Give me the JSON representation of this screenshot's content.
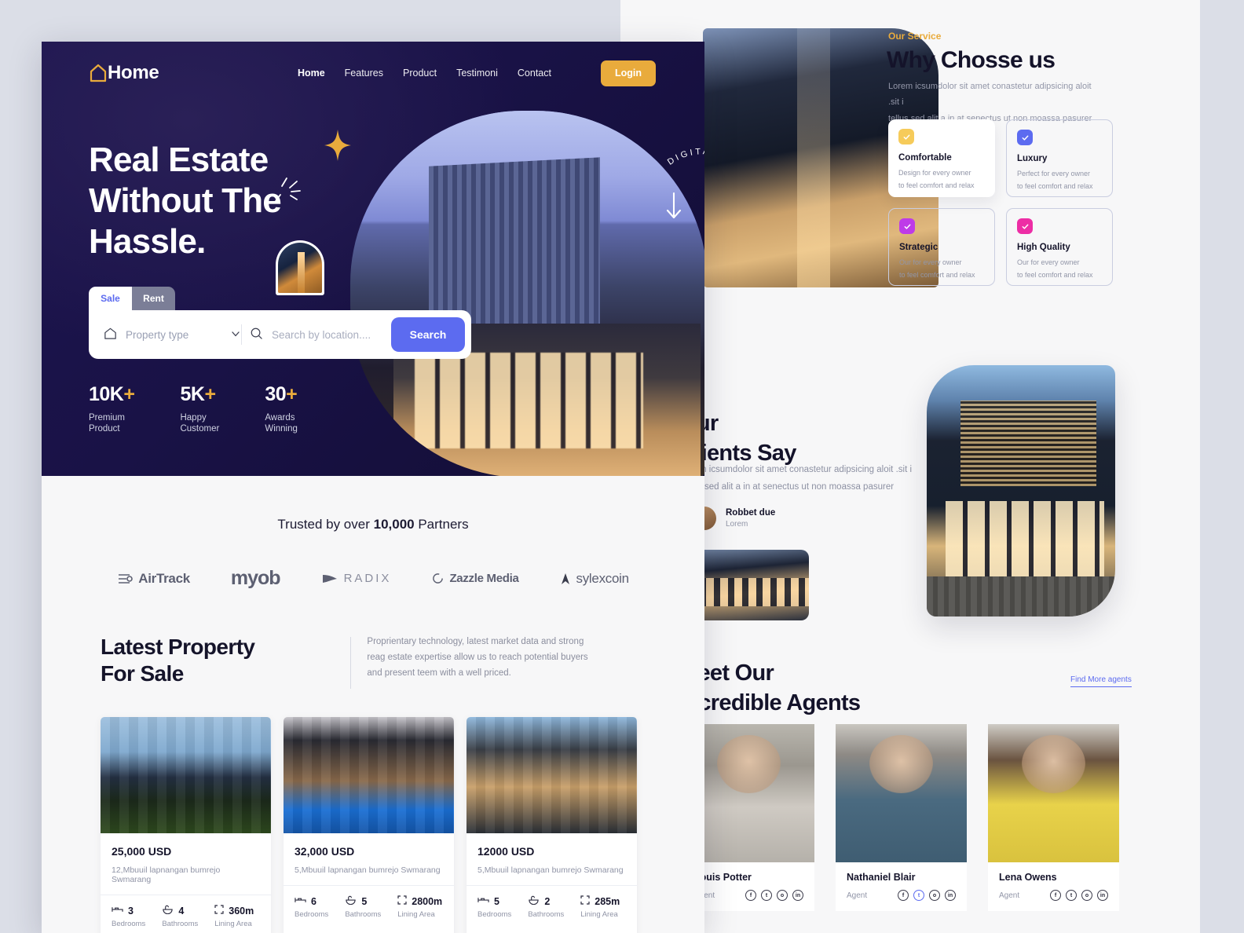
{
  "nav": {
    "logo_text": "Home",
    "logo_icon": "house-outline-icon",
    "links": [
      {
        "label": "Home",
        "active": true
      },
      {
        "label": "Features",
        "active": false
      },
      {
        "label": "Product",
        "active": false
      },
      {
        "label": "Testimoni",
        "active": false
      },
      {
        "label": "Contact",
        "active": false
      }
    ],
    "login_label": "Login"
  },
  "hero": {
    "headline": "Real Estate\nWithout The\nHassle.",
    "badge_text": "DIGITAL AGENCY THAT HELP Y",
    "tabs": [
      {
        "label": "Sale",
        "active": true
      },
      {
        "label": "Rent",
        "active": false
      }
    ],
    "property_type_placeholder": "Property type",
    "location_placeholder": "Search by location....",
    "search_label": "Search",
    "stats": [
      {
        "value": "10K",
        "plus": "+",
        "label": "Premium\nProduct"
      },
      {
        "value": "5K",
        "plus": "+",
        "label": "Happy\nCustomer"
      },
      {
        "value": "30",
        "plus": "+",
        "label": "Awards\nWinning"
      }
    ]
  },
  "partners": {
    "title_pre": "Trusted by over ",
    "title_bold": "10,000",
    "title_post": " Partners",
    "logos": [
      {
        "name": "AirTrack"
      },
      {
        "name": "myob"
      },
      {
        "name": "RADIX"
      },
      {
        "name": "Zazzle Media"
      },
      {
        "name": "sylexcoin"
      }
    ]
  },
  "latest": {
    "title": "Latest Property\nFor Sale",
    "description": "Proprientary technology, latest market data and strong reag estate expertise allow us to reach potential buyers and present teem with a well priced.",
    "cards": [
      {
        "price": "25,000 USD",
        "address": "12,Mbuuil lapnangan bumrejo Swmarang",
        "bedrooms": "3",
        "bedrooms_label": "Bedrooms",
        "bathrooms": "4",
        "bathrooms_label": "Bathrooms",
        "area": "360m",
        "area_label": "Lining Area"
      },
      {
        "price": "32,000 USD",
        "address": "5,Mbuuil lapnangan bumrejo Swmarang",
        "bedrooms": "6",
        "bedrooms_label": "Bedrooms",
        "bathrooms": "5",
        "bathrooms_label": "Bathrooms",
        "area": "2800m",
        "area_label": "Lining Area"
      },
      {
        "price": "12000 USD",
        "address": "5,Mbuuil lapnangan bumrejo Swmarang",
        "bedrooms": "5",
        "bedrooms_label": "Bedrooms",
        "bathrooms": "2",
        "bathrooms_label": "Bathrooms",
        "area": "285m",
        "area_label": "Lining Area"
      }
    ]
  },
  "service": {
    "eyebrow": "Our Service",
    "title": "Why Chosse us",
    "subtitle": "Lorem icsumdolor sit amet conastetur adipsicing aloit .sit i\ntellus sed alit a in at senectus ut non moassa pasurer",
    "cards": [
      {
        "title": "Comfortable",
        "text": "Design for every owner\nto feel comfort and relax",
        "color": "#F6CB5A",
        "style": "shadow"
      },
      {
        "title": "Luxury",
        "text": "Perfect for every owner\nto feel comfort and relax",
        "color": "#5C6BF0",
        "style": "outline"
      },
      {
        "title": "Strategic",
        "text": "Our for every owner\nto feel comfort and relax",
        "color": "#BE3BE8",
        "style": "outline"
      },
      {
        "title": "High Quality",
        "text": "Our for every owner\nto feel comfort and relax",
        "color": "#ED2DA5",
        "style": "outline"
      }
    ]
  },
  "testimonial": {
    "title": "Our\nClients Say",
    "subtitle": "Lorem icsumdolor sit amet conastetur adipsicing aloit .sit i\ntellus sed alit a in at senectus ut non moassa pasurer",
    "person_name": "Robbet due",
    "person_role": "Lorem"
  },
  "agents": {
    "title": "Meet Our\nIncredible Agents",
    "more_label": "Find More agents",
    "list": [
      {
        "name": "Louis Potter",
        "role": "Agent"
      },
      {
        "name": "Nathaniel Blair",
        "role": "Agent"
      },
      {
        "name": "Lena Owens",
        "role": "Agent"
      }
    ]
  },
  "colors": {
    "hero_bg": "#191246",
    "accent_gold": "#E9AB3C",
    "accent_blue": "#5C6BF0",
    "page_bg": "#DBDEE7",
    "panel_bg": "#F7F7F8"
  }
}
